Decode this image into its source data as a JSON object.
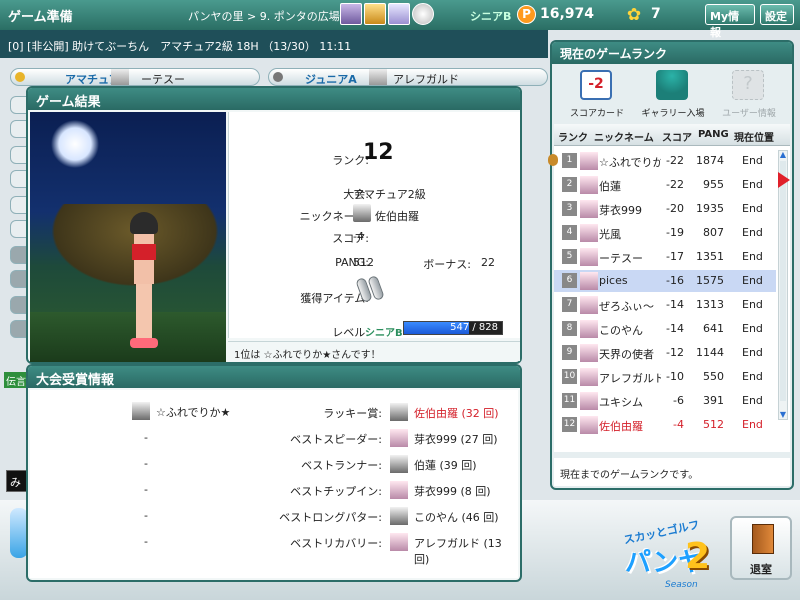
{
  "header": {
    "title": "ゲーム準備",
    "breadcrumb": "パンヤの里 > 9. ポンタの広場",
    "rank_badge": "シニアB",
    "pang_icon": "P",
    "pang": "16,974",
    "gift_count": "7",
    "my_info": "My情報",
    "settings": "設定"
  },
  "subheader": "[0] [非公開] 助けてぶーちん　アマチュア2級 18H （13/30） 11:11",
  "players": {
    "left_label": "アマチュアD",
    "left_name": "ーテスー",
    "right_label": "ジュニアA",
    "right_name": "アレフガルド"
  },
  "dengon": "伝言",
  "chat_stub": "み",
  "game_result": {
    "heading": "ゲーム結果",
    "rank_label": "ランク:",
    "rank": "12",
    "tournament_label": "大会:",
    "tournament": "アマチュア2級",
    "nickname_label": "ニックネーム:",
    "nickname": "佐伯由羅",
    "score_label": "スコア:",
    "score": "-4",
    "pang_label": "PANG:",
    "pang": "512",
    "bonus_label": "ボーナス:",
    "bonus": "22",
    "item_label": "獲得アイテム:",
    "level_label": "レベル:",
    "level_class": "シニアB",
    "level_text": "547 / 828",
    "level_progress": 0.66,
    "footer": "1位は ☆ふれでりか★さんです！"
  },
  "awards": {
    "heading": "大会受賞情報",
    "winner": "☆ふれでりか★",
    "dash": "-",
    "rows": [
      {
        "name": "ラッキー賞:",
        "player": "佐伯由羅 (32 回)"
      },
      {
        "name": "ベストスピーダー:",
        "player": "芽衣999 (27 回)"
      },
      {
        "name": "ベストランナー:",
        "player": "伯蓮 (39 回)"
      },
      {
        "name": "ベストチップイン:",
        "player": "芽衣999 (8 回)"
      },
      {
        "name": "ベストロングパター:",
        "player": "このやん (46 回)"
      },
      {
        "name": "ベストリカバリー:",
        "player": "アレフガルド (13 回)"
      }
    ]
  },
  "ranking": {
    "heading": "現在のゲームランク",
    "tab_score": "スコアカード",
    "tab_score_icon": "-2",
    "tab_gallery": "ギャラリー入場",
    "tab_user": "ユーザー情報",
    "tab_user_icon": "?",
    "columns": [
      "ランク",
      "ニックネーム",
      "スコア",
      "PANG",
      "現在位置"
    ],
    "rows": [
      {
        "rank": "1",
        "nick": "☆ふれでりか★",
        "score": "-22",
        "pang": "1874",
        "pos": "End"
      },
      {
        "rank": "2",
        "nick": "伯蓮",
        "score": "-22",
        "pang": "955",
        "pos": "End"
      },
      {
        "rank": "3",
        "nick": "芽衣999",
        "score": "-20",
        "pang": "1935",
        "pos": "End"
      },
      {
        "rank": "4",
        "nick": "光風",
        "score": "-19",
        "pang": "807",
        "pos": "End"
      },
      {
        "rank": "5",
        "nick": "ーテスー",
        "score": "-17",
        "pang": "1351",
        "pos": "End"
      },
      {
        "rank": "6",
        "nick": "pices",
        "score": "-16",
        "pang": "1575",
        "pos": "End"
      },
      {
        "rank": "7",
        "nick": "ぜろふぃ～",
        "score": "-14",
        "pang": "1313",
        "pos": "End"
      },
      {
        "rank": "8",
        "nick": "このやん",
        "score": "-14",
        "pang": "641",
        "pos": "End"
      },
      {
        "rank": "9",
        "nick": "天界の使者",
        "score": "-12",
        "pang": "1144",
        "pos": "End"
      },
      {
        "rank": "10",
        "nick": "アレフガルド",
        "score": "-10",
        "pang": "550",
        "pos": "End"
      },
      {
        "rank": "11",
        "nick": "ユキシム",
        "score": "-6",
        "pang": "391",
        "pos": "End"
      },
      {
        "rank": "12",
        "nick": "佐伯由羅",
        "score": "-4",
        "pang": "512",
        "pos": "End"
      }
    ],
    "footer": "現在までのゲームランクです。"
  },
  "bottom": {
    "logo_top": "スカッとゴルフ",
    "logo_main": "パンヤ",
    "logo_num": "2",
    "logo_season": "Season",
    "exit_label": "退室"
  }
}
